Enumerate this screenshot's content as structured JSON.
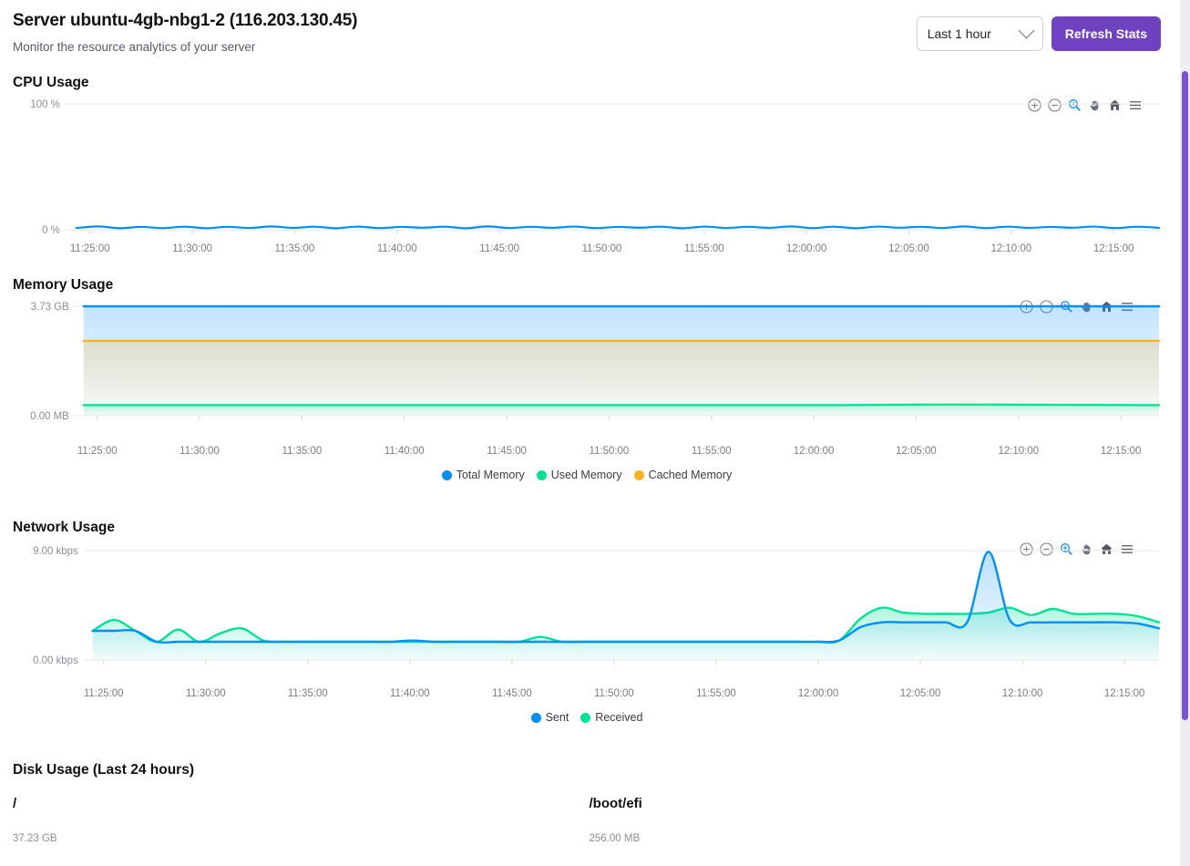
{
  "header": {
    "title": "Server ubuntu-4gb-nbg1-2 (116.203.130.45)",
    "subtitle": "Monitor the resource analytics of your server",
    "range_value": "Last 1 hour",
    "refresh_label": "Refresh Stats"
  },
  "toolbar": {
    "zoom_in": "zoom-in",
    "zoom_out": "zoom-out",
    "selection_zoom": "selection-zoom",
    "panning": "panning",
    "reset": "reset-zoom",
    "menu": "menu"
  },
  "sections": {
    "cpu_title": "CPU Usage",
    "memory_title": "Memory Usage",
    "network_title": "Network Usage",
    "disk_title": "Disk Usage (Last 24 hours)"
  },
  "disk": {
    "mounts": [
      {
        "name": "/",
        "capacity": "37.23 GB"
      },
      {
        "name": "/boot/efi",
        "capacity": "256.00 MB"
      }
    ]
  },
  "colors": {
    "accent": "#6f42c1",
    "scrollbar": "#7b54d6",
    "blue": "#008FFB",
    "green": "#00E396",
    "orange": "#FEB019"
  },
  "chart_data": [
    {
      "id": "cpu",
      "type": "line",
      "title": "CPU Usage",
      "xlabel": "",
      "ylabel": "%",
      "ylim": [
        0,
        100
      ],
      "ytick_labels": [
        "100 %",
        "0 %"
      ],
      "ytick_values": [
        100,
        0
      ],
      "grid": true,
      "legend": [],
      "x": [
        "11:25:00",
        "11:30:00",
        "11:35:00",
        "11:40:00",
        "11:45:00",
        "11:50:00",
        "11:55:00",
        "12:00:00",
        "12:05:00",
        "12:10:00",
        "12:15:00"
      ],
      "series": [
        {
          "name": "CPU",
          "color": "#008FFB",
          "values": [
            1.4,
            2.6,
            1.2,
            2.2,
            1.3,
            2.4,
            1.2,
            2.3,
            1.4,
            2.6,
            1.5,
            2.4,
            1.2,
            2.5,
            1.3,
            2.2,
            1.6,
            2.4,
            1.2,
            2.6,
            1.4,
            2.3,
            1.5,
            2.5,
            1.3,
            2.2,
            1.6,
            2.4,
            1.2,
            2.5,
            1.4,
            2.3,
            1.5,
            2.6,
            1.3,
            2.4,
            1.2,
            2.5,
            1.6,
            2.3,
            1.4,
            2.6,
            1.3,
            2.4,
            1.5,
            2.2,
            1.6,
            2.5,
            1.3,
            2.4,
            1.5
          ]
        }
      ]
    },
    {
      "id": "memory",
      "type": "area",
      "title": "Memory Usage",
      "xlabel": "",
      "ylabel": "GB",
      "ylim": [
        0,
        3.73
      ],
      "ytick_labels": [
        "3.73 GB",
        "0.00 MB"
      ],
      "ytick_values": [
        3.73,
        0
      ],
      "grid": true,
      "legend_position": "bottom",
      "legend": [
        "Total Memory",
        "Used Memory",
        "Cached Memory"
      ],
      "x": [
        "11:25:00",
        "11:30:00",
        "11:35:00",
        "11:40:00",
        "11:45:00",
        "11:50:00",
        "11:55:00",
        "12:00:00",
        "12:05:00",
        "12:10:00",
        "12:15:00"
      ],
      "series": [
        {
          "name": "Total Memory",
          "color": "#008FFB",
          "values": [
            3.73,
            3.73,
            3.73,
            3.73,
            3.73,
            3.73,
            3.73,
            3.73,
            3.73,
            3.73,
            3.73
          ]
        },
        {
          "name": "Used Memory",
          "color": "#00E396",
          "values": [
            0.36,
            0.36,
            0.36,
            0.36,
            0.36,
            0.36,
            0.36,
            0.36,
            0.38,
            0.37,
            0.36
          ]
        },
        {
          "name": "Cached Memory",
          "color": "#FEB019",
          "values": [
            2.55,
            2.55,
            2.55,
            2.55,
            2.55,
            2.55,
            2.55,
            2.55,
            2.55,
            2.55,
            2.55
          ]
        }
      ]
    },
    {
      "id": "network",
      "type": "area",
      "title": "Network Usage",
      "xlabel": "",
      "ylabel": "kbps",
      "ylim": [
        0,
        9.0
      ],
      "ytick_labels": [
        "9.00 kbps",
        "0.00 kbps"
      ],
      "ytick_values": [
        9.0,
        0
      ],
      "grid": true,
      "legend_position": "bottom",
      "legend": [
        "Sent",
        "Received"
      ],
      "x": [
        "11:25:00",
        "11:30:00",
        "11:35:00",
        "11:40:00",
        "11:45:00",
        "11:50:00",
        "11:55:00",
        "12:00:00",
        "12:05:00",
        "12:10:00",
        "12:15:00"
      ],
      "series": [
        {
          "name": "Sent",
          "color": "#008FFB",
          "values": [
            2.4,
            2.4,
            2.4,
            1.5,
            1.5,
            1.5,
            1.5,
            1.5,
            1.5,
            1.5,
            1.5,
            1.5,
            1.5,
            1.5,
            1.5,
            1.6,
            1.5,
            1.5,
            1.5,
            1.5,
            1.5,
            1.5,
            1.5,
            1.5,
            1.5,
            1.5,
            1.5,
            1.5,
            1.5,
            1.5,
            1.5,
            1.5,
            1.5,
            1.5,
            1.5,
            1.6,
            2.7,
            3.1,
            3.1,
            3.1,
            3.1,
            3.1,
            8.9,
            3.3,
            3.1,
            3.1,
            3.1,
            3.1,
            3.1,
            3.0,
            2.6
          ]
        },
        {
          "name": "Received",
          "color": "#00E396",
          "values": [
            2.4,
            3.3,
            2.4,
            1.5,
            2.5,
            1.5,
            2.2,
            2.6,
            1.6,
            1.5,
            1.5,
            1.5,
            1.5,
            1.5,
            1.5,
            1.5,
            1.5,
            1.5,
            1.5,
            1.5,
            1.5,
            1.9,
            1.5,
            1.5,
            1.5,
            1.5,
            1.5,
            1.5,
            1.5,
            1.5,
            1.5,
            1.5,
            1.5,
            1.5,
            1.5,
            1.6,
            3.4,
            4.3,
            3.9,
            3.8,
            3.8,
            3.8,
            3.9,
            4.3,
            3.7,
            4.2,
            3.8,
            3.8,
            3.8,
            3.6,
            3.1
          ]
        }
      ]
    }
  ]
}
